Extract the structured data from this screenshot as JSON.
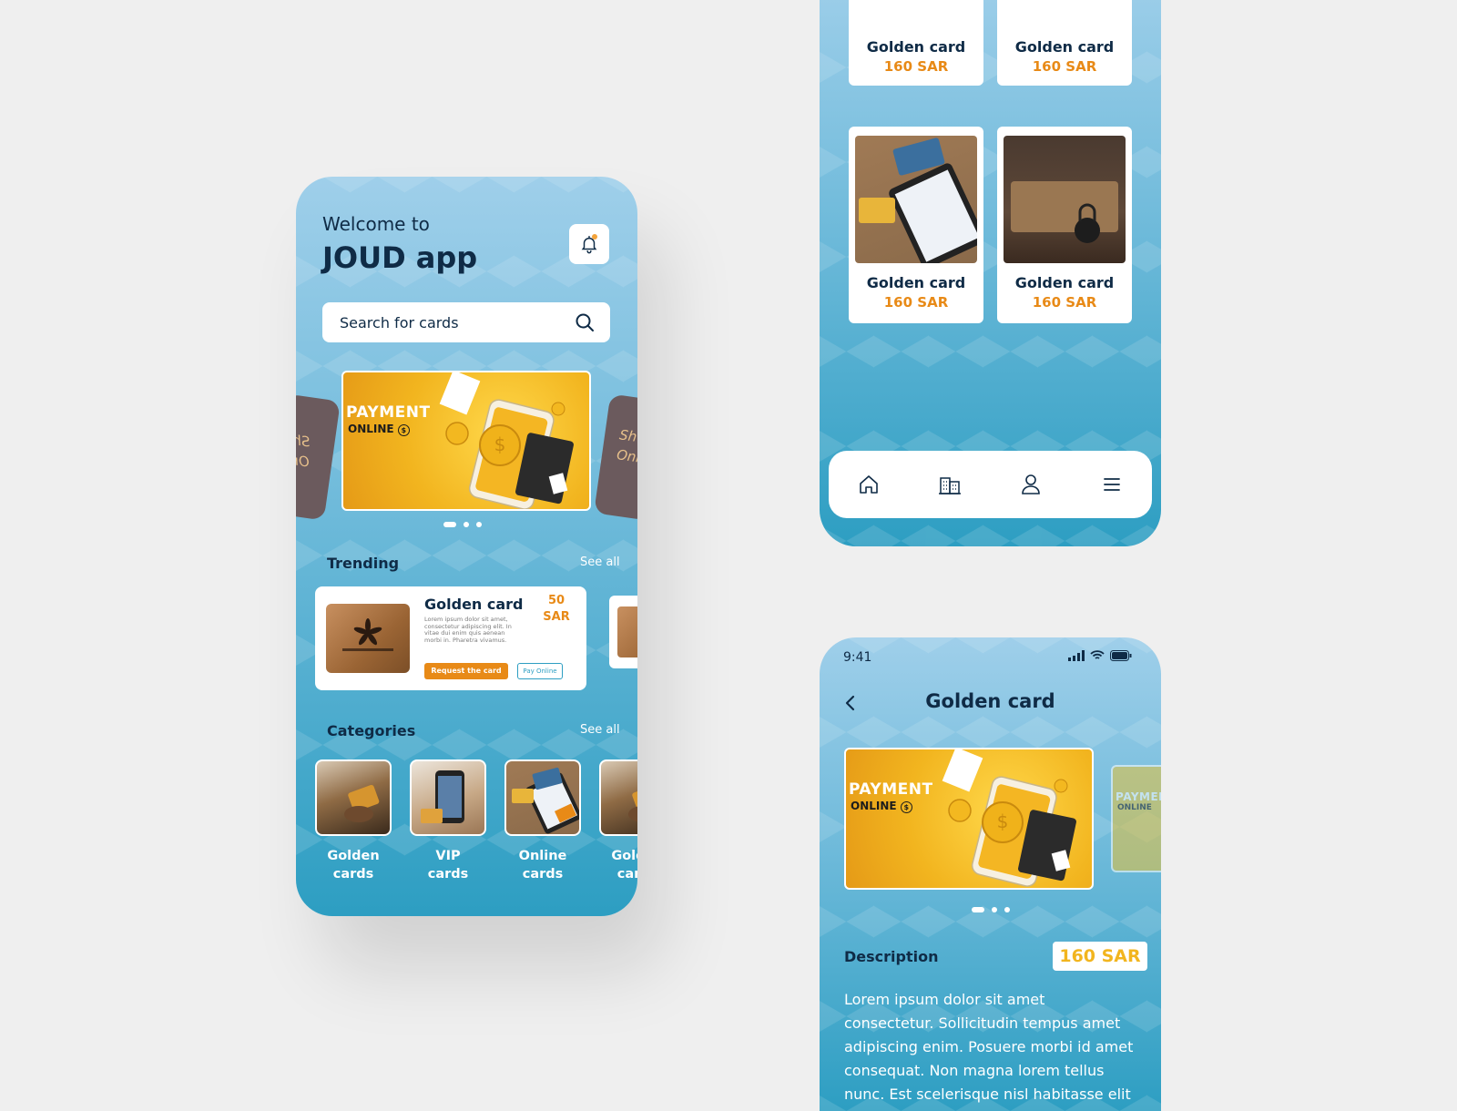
{
  "home": {
    "welcome": "Welcome to",
    "app_title": "JOUD app",
    "search_placeholder": "Search for cards",
    "banner": {
      "line1": "PAYMENT",
      "line2": "ONLINE"
    },
    "trending": {
      "title": "Trending",
      "see_all": "See all",
      "card": {
        "name": "Golden card",
        "price_amount": "50",
        "price_currency": "SAR",
        "description": "Lorem ipsum dolor sit amet, consectetur adipiscing elit. In vitae dui enim quis aenean morbi in. Pharetra vivamus.",
        "request_label": "Request the card",
        "pay_label": "Pay Online"
      }
    },
    "categories": {
      "title": "Categories",
      "see_all": "See all",
      "items": [
        {
          "line1": "Golden",
          "line2": "cards"
        },
        {
          "line1": "VIP",
          "line2": "cards"
        },
        {
          "line1": "Online",
          "line2": "cards"
        },
        {
          "line1": "Golden",
          "line2": "cards"
        }
      ]
    }
  },
  "grid": {
    "items": [
      {
        "name": "Golden card",
        "price": "160 SAR"
      },
      {
        "name": "Golden card",
        "price": "160 SAR"
      },
      {
        "name": "Golden card",
        "price": "160 SAR"
      },
      {
        "name": "Golden card",
        "price": "160 SAR"
      }
    ],
    "nav": [
      "home-icon",
      "buildings-icon",
      "user-icon",
      "menu-icon"
    ]
  },
  "detail": {
    "status_time": "9:41",
    "title": "Golden card",
    "banner": {
      "line1": "PAYMENT",
      "line2": "ONLINE"
    },
    "description_label": "Description",
    "price": "160 SAR",
    "description": "Lorem ipsum dolor sit amet consectetur. Sollicitudin tempus amet adipiscing enim. Posuere morbi id amet consequat. Non magna lorem tellus nunc. Est scelerisque nisl habitasse elit eu eget. Tellus magna"
  },
  "colors": {
    "accent": "#e88a17",
    "gold": "#f2b51f",
    "text_dark": "#0f2b46",
    "bg_top": "#9fcfea",
    "bg_bottom": "#2d9ec2"
  }
}
